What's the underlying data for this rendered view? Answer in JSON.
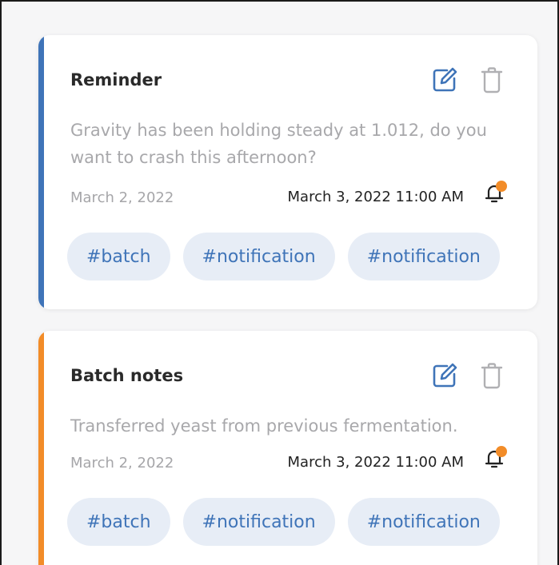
{
  "colors": {
    "accent_blue": "#3f74b8",
    "accent_orange": "#f28c28",
    "tag_bg": "#e7edf6",
    "notification_dot": "#f28c28"
  },
  "notes": [
    {
      "title": "Reminder",
      "body": "Gravity has been holding steady at 1.012, do you want to crash this afternoon?",
      "created": "March 2, 2022",
      "reminder": "March 3, 2022 11:00 AM",
      "accent": "blue",
      "icons": {
        "edit": "edit-icon",
        "delete": "trash-icon",
        "reminder": "bell-icon"
      },
      "tags": [
        "#batch",
        "#notification",
        "#notification"
      ]
    },
    {
      "title": "Batch notes",
      "body": "Transferred yeast from previous fermentation.",
      "created": "March 2, 2022",
      "reminder": "March 3, 2022 11:00 AM",
      "accent": "orange",
      "icons": {
        "edit": "edit-icon",
        "delete": "trash-icon",
        "reminder": "bell-icon"
      },
      "tags": [
        "#batch",
        "#notification",
        "#notification"
      ]
    }
  ]
}
